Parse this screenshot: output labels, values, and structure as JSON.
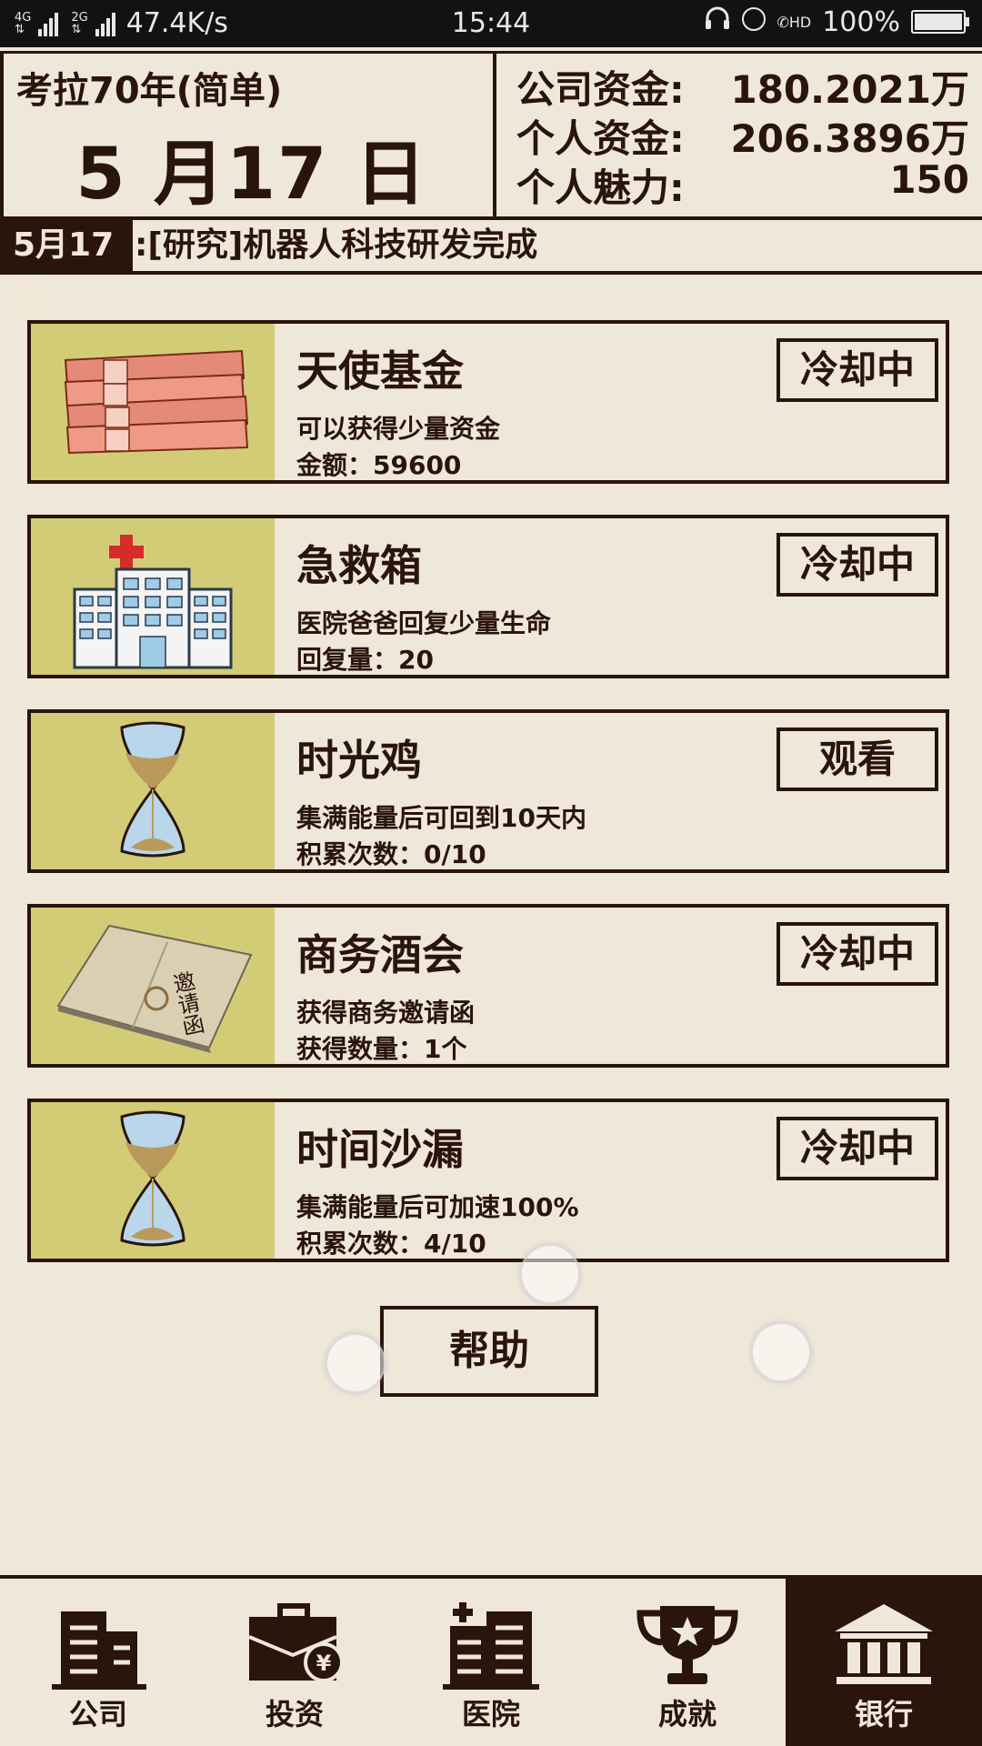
{
  "status_bar": {
    "network_a": "4G",
    "network_b": "2G",
    "speed": "47.4K/s",
    "time": "15:44",
    "hd": "HD",
    "battery": "100%",
    "battery_level": 1.0
  },
  "header": {
    "game_title": "考拉70年(简单)",
    "date": "5 月17 日",
    "stats": [
      {
        "label": "公司资金:",
        "value": "180.2021万"
      },
      {
        "label": "个人资金:",
        "value": "206.3896万"
      },
      {
        "label": "个人魅力:",
        "value": "150"
      }
    ]
  },
  "ticker": {
    "date": "5月17日",
    "text": ":[研究]机器人科技研发完成"
  },
  "cards": [
    {
      "name": "天使基金",
      "desc": "可以获得少量资金",
      "amount": "金额：59600",
      "button": "冷却中",
      "icon": "money-stack-icon"
    },
    {
      "name": "急救箱",
      "desc": "医院爸爸回复少量生命",
      "amount": "回复量：20",
      "button": "冷却中",
      "icon": "hospital-icon"
    },
    {
      "name": "时光鸡",
      "desc": "集满能量后可回到10天内",
      "amount": "积累次数：0/10",
      "button": "观看",
      "icon": "hourglass-icon"
    },
    {
      "name": "商务酒会",
      "desc": "获得商务邀请函",
      "amount": "获得数量：1个",
      "button": "冷却中",
      "icon": "invitation-icon",
      "icon_text": "邀请函"
    },
    {
      "name": "时间沙漏",
      "desc": "集满能量后可加速100%",
      "amount": "积累次数：4/10",
      "button": "冷却中",
      "icon": "hourglass-icon"
    }
  ],
  "help_button": "帮助",
  "nav": [
    {
      "label": "公司",
      "icon": "company-building-icon"
    },
    {
      "label": "投资",
      "icon": "briefcase-yen-icon"
    },
    {
      "label": "医院",
      "icon": "hospital-building-icon"
    },
    {
      "label": "成就",
      "icon": "trophy-icon"
    },
    {
      "label": "银行",
      "icon": "bank-icon",
      "active": true
    }
  ],
  "colors": {
    "background": "#efe7d8",
    "ink": "#2a140e",
    "thumb": "#d3cc77"
  }
}
